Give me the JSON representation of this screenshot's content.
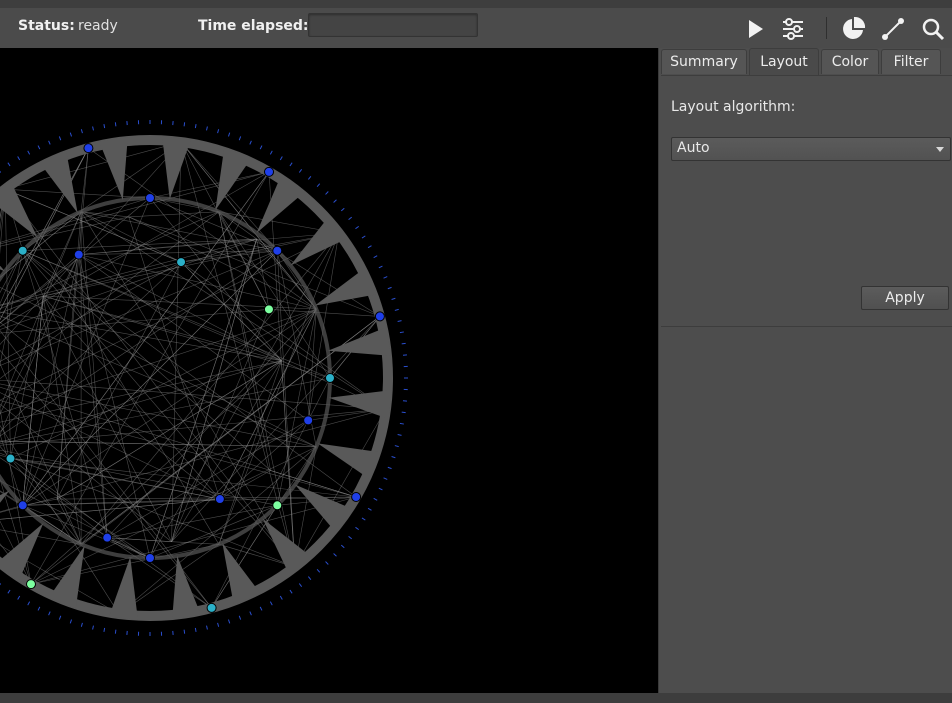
{
  "toolbar": {
    "status_label": "Status:",
    "status_value": "ready",
    "time_label": "Time elapsed:",
    "time_value": "",
    "icons": [
      "play-icon",
      "sliders-icon",
      "pie-chart-icon",
      "edge-line-icon",
      "search-icon"
    ]
  },
  "tabs": [
    {
      "label": "Summary",
      "active": false
    },
    {
      "label": "Layout",
      "active": true
    },
    {
      "label": "Color",
      "active": false
    },
    {
      "label": "Filter",
      "active": false
    }
  ],
  "layout_panel": {
    "algorithm_label": "Layout algorithm:",
    "algorithm_value": "Auto",
    "apply_label": "Apply"
  },
  "colors": {
    "background": "#4d4d4d",
    "canvas": "#000000",
    "graph_gray": "#595959",
    "node_blue": "#1f3fe8",
    "node_cyan": "#2bb0c8",
    "node_green": "#7dffa0"
  }
}
